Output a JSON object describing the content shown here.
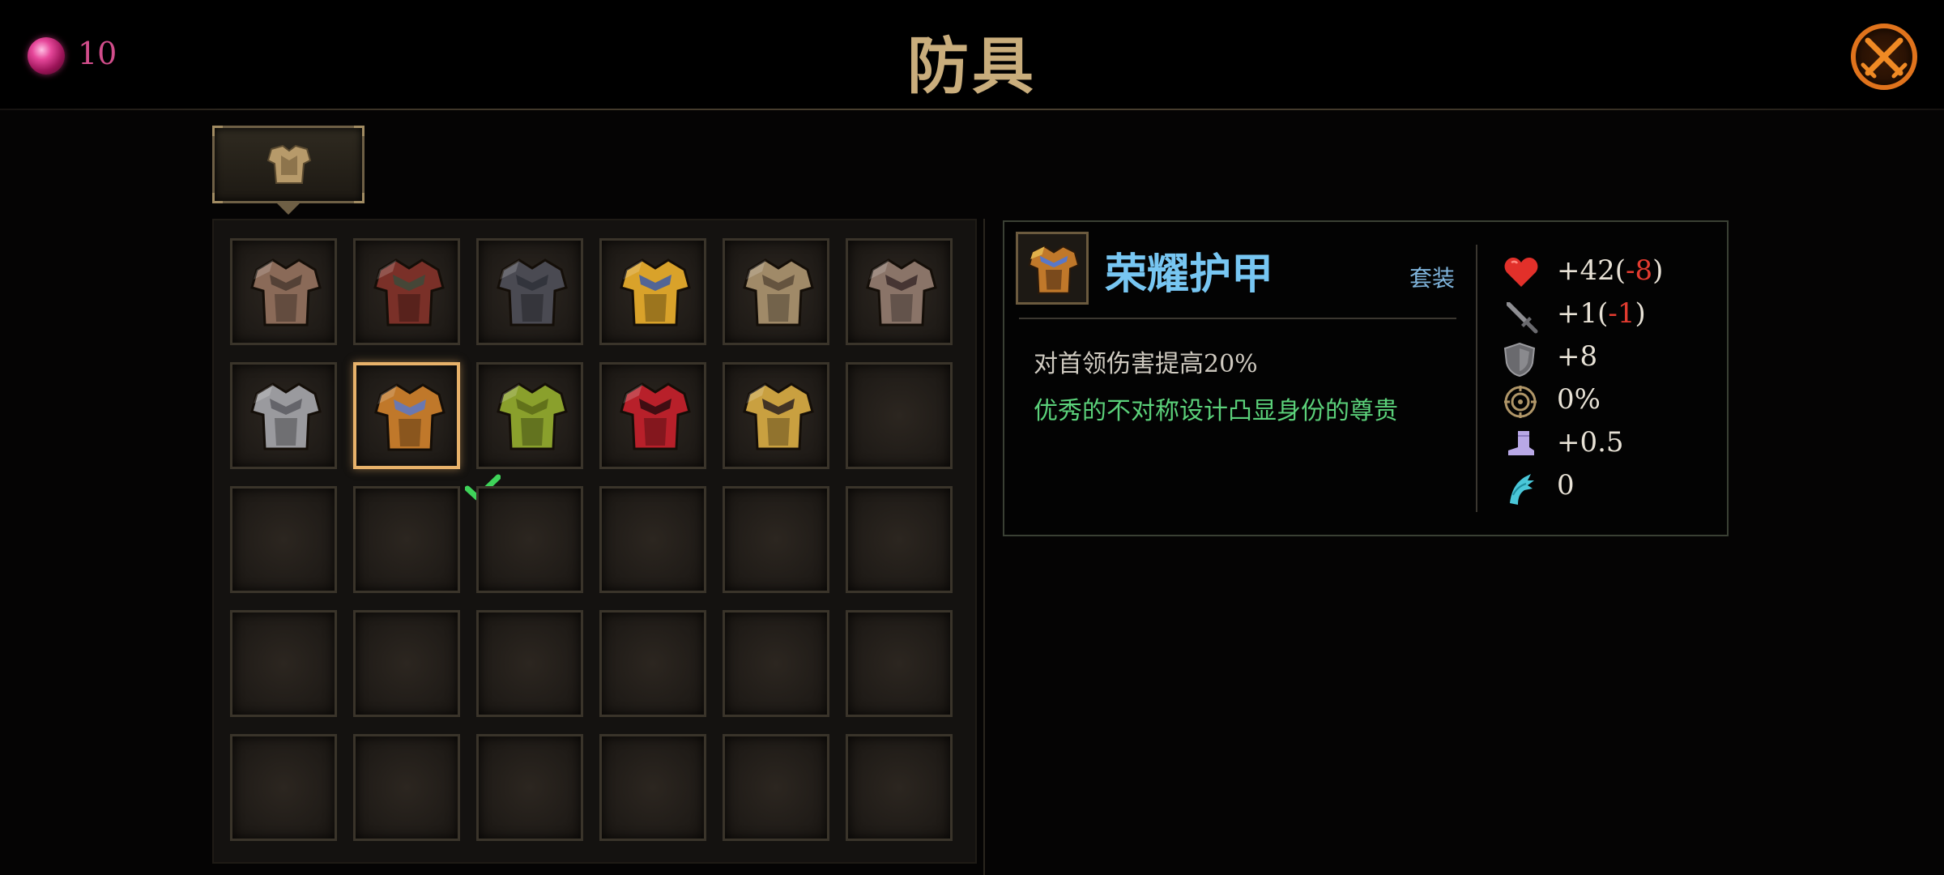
{
  "currency": {
    "icon": "pink-gem-icon",
    "count": "10",
    "color": "#d24d8b"
  },
  "title": "防具",
  "close_icon": "close-crossed-swords-icon",
  "category_tab": {
    "icon": "chest-armor-icon",
    "selected": true
  },
  "grid": {
    "columns": 6,
    "rows": 5,
    "items": [
      {
        "icon": "leather-armor-icon",
        "color": "#8a6a58"
      },
      {
        "icon": "fur-armor-icon",
        "color": "#7a3028"
      },
      {
        "icon": "dark-plate-armor-icon",
        "color": "#4a4a52"
      },
      {
        "icon": "golden-winged-armor-icon",
        "color": "#d9a22a"
      },
      {
        "icon": "bone-armor-icon",
        "color": "#a08a68"
      },
      {
        "icon": "steel-armor-icon",
        "color": "#8a7468"
      },
      {
        "icon": "iron-plate-armor-icon",
        "color": "#9a9a9e"
      },
      {
        "icon": "glory-armor-icon",
        "color": "#c0782a",
        "selected": true,
        "equipped": true
      },
      {
        "icon": "jade-armor-icon",
        "color": "#8aa02c"
      },
      {
        "icon": "crimson-armor-icon",
        "color": "#b8202a"
      },
      {
        "icon": "samurai-armor-icon",
        "color": "#c9a040"
      }
    ]
  },
  "detail": {
    "name": "荣耀护甲",
    "set_label": "套装",
    "description": "对首领伤害提高20%",
    "flavor": "优秀的不对称设计凸显身份的尊贵",
    "stats": [
      {
        "icon": "heart-icon",
        "value": "+42(",
        "delta": "-8",
        "close": ")"
      },
      {
        "icon": "sword-icon",
        "value": "+1(",
        "delta": "-1",
        "close": ")"
      },
      {
        "icon": "shield-icon",
        "value": "+8",
        "delta": "",
        "close": ""
      },
      {
        "icon": "crit-target-icon",
        "value": "0%",
        "delta": "",
        "close": ""
      },
      {
        "icon": "boot-speed-icon",
        "value": "+0.5",
        "delta": "",
        "close": ""
      },
      {
        "icon": "claw-icon",
        "value": "0",
        "delta": "",
        "close": ""
      }
    ]
  }
}
